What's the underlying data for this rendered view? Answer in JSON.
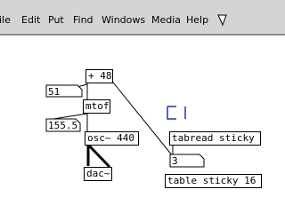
{
  "menubar": {
    "items": [
      "ile",
      "Edit",
      "Put",
      "Find",
      "Windows",
      "Media",
      "Help"
    ]
  },
  "patch": {
    "objects": {
      "plus": "+ 48",
      "mtof": "mtof",
      "osc": "osc~ 440",
      "dac": "dac~",
      "tabread": "tabread sticky",
      "table": "table sticky 16"
    },
    "numbers": {
      "num51": "51",
      "num155": "155.5",
      "num3": "3"
    }
  }
}
